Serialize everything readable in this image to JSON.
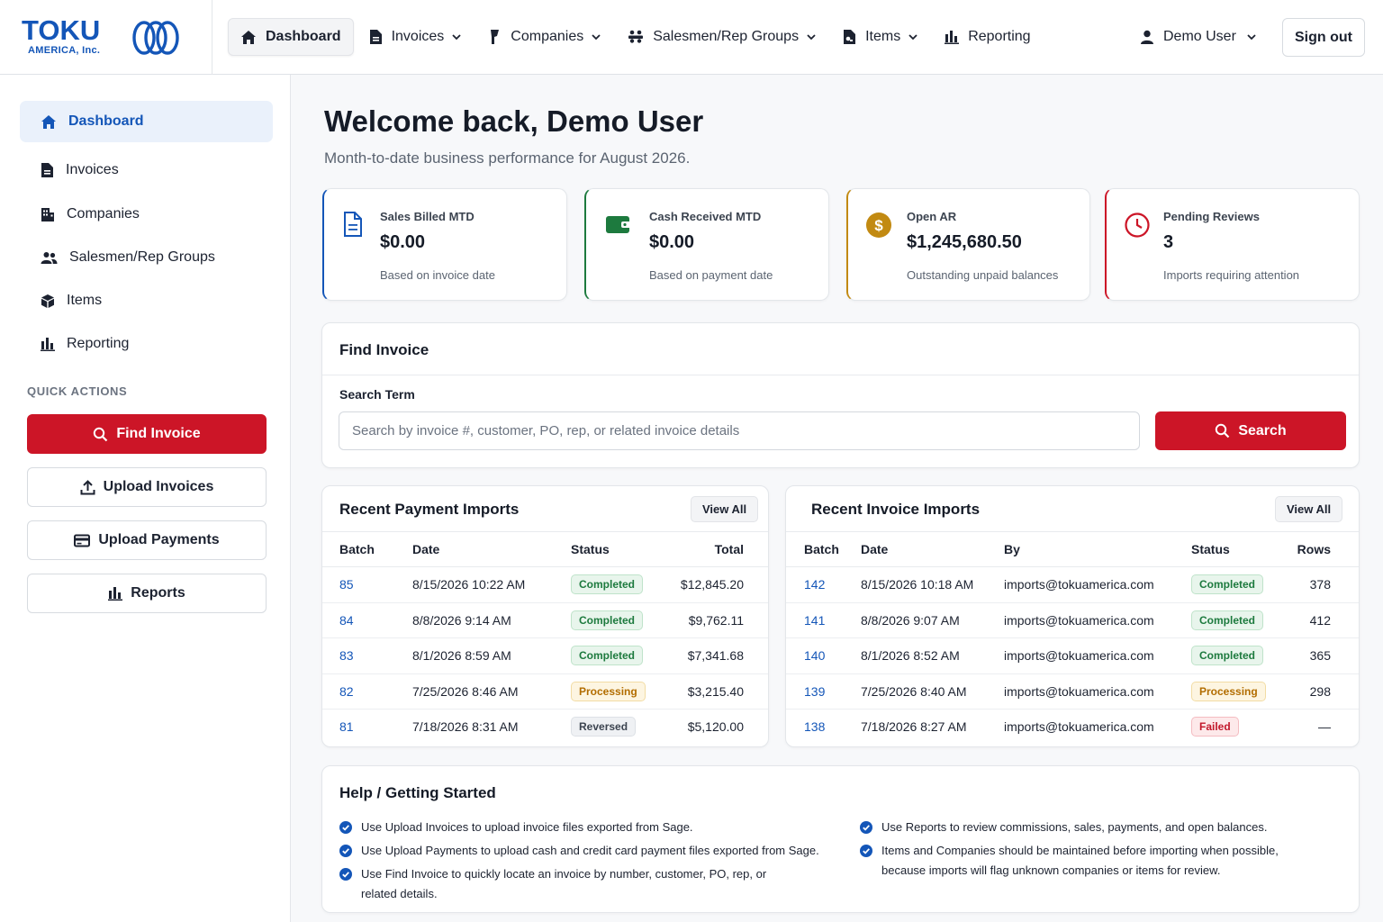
{
  "brand": {
    "name": "TOKU",
    "sub": "AMERICA, Inc."
  },
  "nav": {
    "items": [
      {
        "label": "Dashboard"
      },
      {
        "label": "Invoices"
      },
      {
        "label": "Companies"
      },
      {
        "label": "Salesmen/Rep Groups"
      },
      {
        "label": "Items"
      },
      {
        "label": "Reporting"
      }
    ],
    "user": "Demo User",
    "signout": "Sign out"
  },
  "sidebar": {
    "items": [
      {
        "label": "Dashboard"
      },
      {
        "label": "Invoices"
      },
      {
        "label": "Companies"
      },
      {
        "label": "Salesmen/Rep Groups"
      },
      {
        "label": "Items"
      },
      {
        "label": "Reporting"
      }
    ],
    "quick_actions_label": "QUICK ACTIONS",
    "quick_actions": [
      {
        "label": "Find Invoice"
      },
      {
        "label": "Upload Invoices"
      },
      {
        "label": "Upload Payments"
      },
      {
        "label": "Reports"
      }
    ]
  },
  "header": {
    "title": "Welcome back, Demo User",
    "subtitle": "Month-to-date business performance for August 2026."
  },
  "kpis": [
    {
      "label": "Sales Billed MTD",
      "value": "$0.00",
      "note": "Based on invoice date",
      "color": "#1456b8"
    },
    {
      "label": "Cash Received MTD",
      "value": "$0.00",
      "note": "Based on payment date",
      "color": "#1d7a3e"
    },
    {
      "label": "Open AR",
      "value": "$1,245,680.50",
      "note": "Outstanding unpaid balances",
      "color": "#c28a12"
    },
    {
      "label": "Pending Reviews",
      "value": "3",
      "note": "Imports requiring attention",
      "color": "#cc1527"
    }
  ],
  "find_invoice": {
    "title": "Find Invoice",
    "search_label": "Search Term",
    "placeholder": "Search by invoice #, customer, PO, rep, or related invoice details",
    "button": "Search"
  },
  "payment_imports": {
    "title": "Recent Payment Imports",
    "view_all": "View All",
    "columns": [
      "Batch",
      "Date",
      "Status",
      "Total"
    ],
    "rows": [
      {
        "batch": "85",
        "date": "8/15/2026 10:22 AM",
        "status": "Completed",
        "total": "$12,845.20"
      },
      {
        "batch": "84",
        "date": "8/8/2026 9:14 AM",
        "status": "Completed",
        "total": "$9,762.11"
      },
      {
        "batch": "83",
        "date": "8/1/2026 8:59 AM",
        "status": "Completed",
        "total": "$7,341.68"
      },
      {
        "batch": "82",
        "date": "7/25/2026 8:46 AM",
        "status": "Processing",
        "total": "$3,215.40"
      },
      {
        "batch": "81",
        "date": "7/18/2026 8:31 AM",
        "status": "Reversed",
        "total": "$5,120.00"
      }
    ]
  },
  "invoice_imports": {
    "title": "Recent Invoice Imports",
    "view_all": "View All",
    "columns": [
      "Batch",
      "Date",
      "By",
      "Status",
      "Rows"
    ],
    "rows": [
      {
        "batch": "142",
        "date": "8/15/2026 10:18 AM",
        "by": "imports@tokuamerica.com",
        "status": "Completed",
        "rows": "378"
      },
      {
        "batch": "141",
        "date": "8/8/2026 9:07 AM",
        "by": "imports@tokuamerica.com",
        "status": "Completed",
        "rows": "412"
      },
      {
        "batch": "140",
        "date": "8/1/2026 8:52 AM",
        "by": "imports@tokuamerica.com",
        "status": "Completed",
        "rows": "365"
      },
      {
        "batch": "139",
        "date": "7/25/2026 8:40 AM",
        "by": "imports@tokuamerica.com",
        "status": "Processing",
        "rows": "298"
      },
      {
        "batch": "138",
        "date": "7/18/2026 8:27 AM",
        "by": "imports@tokuamerica.com",
        "status": "Failed",
        "rows": "—"
      }
    ]
  },
  "help": {
    "title": "Help / Getting Started",
    "left": [
      "Use Upload Invoices to upload invoice files exported from Sage.",
      "Use Upload Payments to upload cash and credit card payment files exported from Sage.",
      "Use Find Invoice to quickly locate an invoice by number, customer, PO, rep, or related details."
    ],
    "right": [
      "Use Reports to review commissions, sales, payments, and open balances.",
      "Items and Companies should be maintained before importing when possible, because imports will flag unknown companies or items for review."
    ]
  }
}
